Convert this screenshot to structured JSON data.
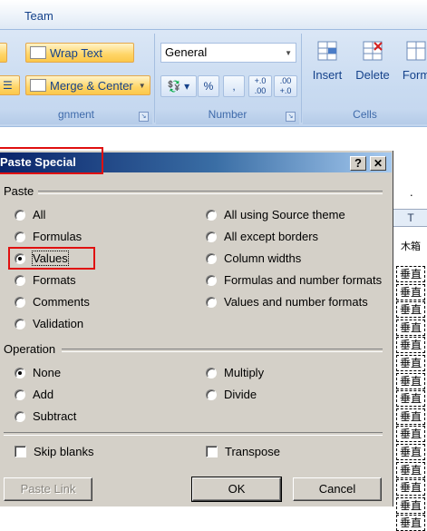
{
  "ribbon": {
    "tab_label": "Team",
    "wrap_text_label": "Wrap Text",
    "merge_center_label": "Merge & Center",
    "alignment_group_label": "gnment",
    "number_format_value": "General",
    "number_group_label": "Number",
    "percent_label": "%",
    "comma_label": ",",
    "increase_decimal_label": "+.0 .00",
    "decrease_decimal_label": ".00 +.0",
    "insert_label": "Insert",
    "delete_label": "Delete",
    "format_label": "Form",
    "cells_group_label": "Cells"
  },
  "sheet": {
    "top_mark": ".",
    "column_header": "T",
    "first_cell": "木箱",
    "cells": [
      "垂直",
      "垂直",
      "垂直",
      "垂直",
      "垂直",
      "垂直",
      "垂直",
      "垂直",
      "垂直",
      "垂直",
      "垂直",
      "垂直",
      "垂直",
      "垂直",
      "垂直"
    ]
  },
  "dialog": {
    "title": "Paste Special",
    "help_button": "?",
    "close_button": "✕",
    "paste_section": "Paste",
    "paste_options_left": [
      "All",
      "Formulas",
      "Values",
      "Formats",
      "Comments",
      "Validation"
    ],
    "paste_options_right": [
      "All using Source theme",
      "All except borders",
      "Column widths",
      "Formulas and number formats",
      "Values and number formats"
    ],
    "selected_paste": "Values",
    "operation_section": "Operation",
    "operation_left": [
      "None",
      "Add",
      "Subtract"
    ],
    "operation_right": [
      "Multiply",
      "Divide"
    ],
    "selected_operation": "None",
    "skip_blanks_label": "Skip blanks",
    "transpose_label": "Transpose",
    "paste_link_button": "Paste Link",
    "ok_button": "OK",
    "cancel_button": "Cancel"
  },
  "colors": {
    "highlight_box": "#e01010",
    "title_bar": "#0a246a",
    "dialog_face": "#d4d0c8"
  }
}
